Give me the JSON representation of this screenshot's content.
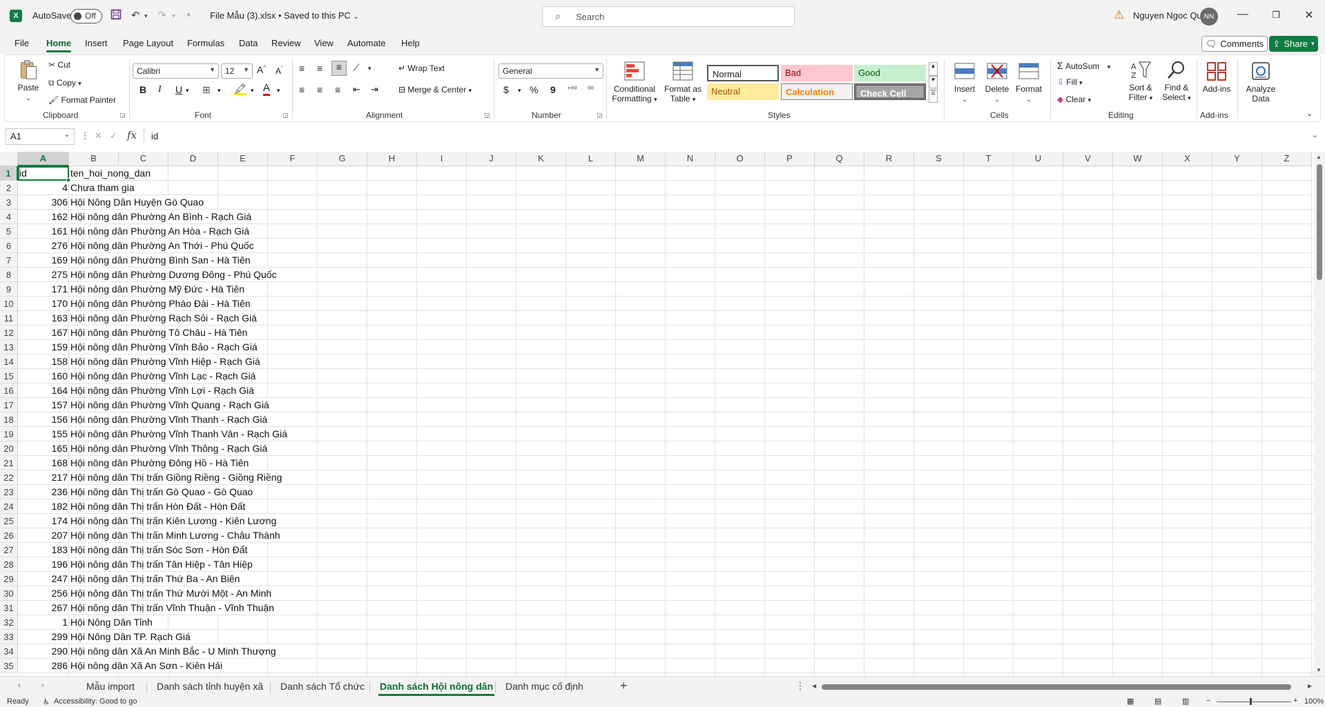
{
  "titlebar": {
    "autosave_label": "AutoSave",
    "autosave_state": "Off",
    "file_title": "File Mẫu (3).xlsx • Saved to this PC",
    "search_placeholder": "Search",
    "user_name": "Nguyen Ngoc Qui",
    "user_initials": "NN"
  },
  "menu": {
    "tabs": [
      "File",
      "Home",
      "Insert",
      "Page Layout",
      "Formulas",
      "Data",
      "Review",
      "View",
      "Automate",
      "Help"
    ],
    "active": "Home",
    "comments_label": "Comments",
    "share_label": "Share"
  },
  "ribbon": {
    "clipboard": {
      "paste": "Paste",
      "cut": "Cut",
      "copy": "Copy",
      "format_painter": "Format Painter",
      "label": "Clipboard"
    },
    "font": {
      "name": "Calibri",
      "size": "12",
      "label": "Font",
      "bold": "B",
      "italic": "I",
      "underline": "U",
      "grow": "A",
      "shrink": "A"
    },
    "alignment": {
      "wrap_text": "Wrap Text",
      "merge_center": "Merge & Center",
      "label": "Alignment"
    },
    "number": {
      "format": "General",
      "label": "Number",
      "currency": "$",
      "percent": "%",
      "comma": "9"
    },
    "styles": {
      "conditional_formatting": "Conditional Formatting",
      "format_as_table": "Format as Table",
      "normal": "Normal",
      "bad": "Bad",
      "good": "Good",
      "neutral": "Neutral",
      "calculation": "Calculation",
      "check_cell": "Check Cell",
      "label": "Styles"
    },
    "cells": {
      "insert": "Insert",
      "delete": "Delete",
      "format": "Format",
      "label": "Cells"
    },
    "editing": {
      "autosum": "AutoSum",
      "fill": "Fill",
      "clear": "Clear",
      "sort_filter": "Sort & Filter",
      "find_select": "Find & Select",
      "label": "Editing"
    },
    "addins": {
      "addins": "Add-ins",
      "label": "Add-ins"
    },
    "analyze": {
      "label": "Analyze Data"
    }
  },
  "formula_bar": {
    "name_box": "A1",
    "fx": "fx",
    "content": "id"
  },
  "grid": {
    "columns": [
      "A",
      "B",
      "C",
      "D",
      "E",
      "F",
      "G",
      "H",
      "I",
      "J",
      "K",
      "L",
      "M",
      "N",
      "O",
      "P",
      "Q",
      "R",
      "S",
      "T",
      "U",
      "V",
      "W",
      "X",
      "Y",
      "Z"
    ],
    "row_numbers": [
      "1",
      "2",
      "3",
      "4",
      "5",
      "6",
      "7",
      "8",
      "9",
      "10",
      "11",
      "12",
      "13",
      "14",
      "15",
      "16",
      "17",
      "18",
      "19",
      "20",
      "21",
      "22",
      "23",
      "24",
      "25",
      "26",
      "27",
      "28",
      "29",
      "30",
      "31",
      "32",
      "33",
      "34",
      "35"
    ],
    "rows": [
      [
        "id",
        "ten_hoi_nong_dan"
      ],
      [
        "4",
        "Chưa tham gia"
      ],
      [
        "306",
        "Hội Nông Dân Huyện Gò Quao"
      ],
      [
        "162",
        "Hội nông dân Phường An Bình -  Rạch Giá"
      ],
      [
        "161",
        "Hội nông dân Phường An Hòa -  Rạch Giá"
      ],
      [
        "276",
        "Hội nông dân Phường An Thới -  Phú Quốc"
      ],
      [
        "169",
        "Hội nông dân Phường Bình San -  Hà Tiên"
      ],
      [
        "275",
        "Hội nông dân Phường Dương Đông -  Phú Quốc"
      ],
      [
        "171",
        "Hội nông dân Phường Mỹ Đức -  Hà Tiên"
      ],
      [
        "170",
        "Hội nông dân Phường Pháo Đài -  Hà Tiên"
      ],
      [
        "163",
        "Hội nông dân Phường Rạch Sỏi -  Rạch Giá"
      ],
      [
        "167",
        "Hội nông dân Phường Tô Châu -  Hà Tiên"
      ],
      [
        "159",
        "Hội nông dân Phường Vĩnh Bảo -  Rạch Giá"
      ],
      [
        "158",
        "Hội nông dân Phường Vĩnh Hiệp -  Rạch Giá"
      ],
      [
        "160",
        "Hội nông dân Phường Vĩnh Lạc -  Rạch Giá"
      ],
      [
        "164",
        "Hội nông dân Phường Vĩnh Lợi -  Rạch Giá"
      ],
      [
        "157",
        "Hội nông dân Phường Vĩnh Quang -  Rạch Giá"
      ],
      [
        "156",
        "Hội nông dân Phường Vĩnh Thanh -  Rạch Giá"
      ],
      [
        "155",
        "Hội nông dân Phường Vĩnh Thanh Vân -  Rạch Giá"
      ],
      [
        "165",
        "Hội nông dân Phường Vĩnh Thông -  Rạch Giá"
      ],
      [
        "168",
        "Hội nông dân Phường Đông Hồ -  Hà Tiên"
      ],
      [
        "217",
        "Hội nông dân Thị trấn Giồng Riềng -  Giồng Riềng"
      ],
      [
        "236",
        "Hội nông dân Thị trấn Gò Quao -  Gò Quao"
      ],
      [
        "182",
        "Hội nông dân Thị trấn Hòn Đất -  Hòn Đất"
      ],
      [
        "174",
        "Hội nông dân Thị trấn Kiên Lương -  Kiên Lương"
      ],
      [
        "207",
        "Hội nông dân Thị trấn Minh Lương -  Châu Thành"
      ],
      [
        "183",
        "Hội nông dân Thị trấn Sóc Sơn -  Hòn Đất"
      ],
      [
        "196",
        "Hội nông dân Thị trấn Tân Hiệp -  Tân Hiệp"
      ],
      [
        "247",
        "Hội nông dân Thị trấn Thứ Ba -  An Biên"
      ],
      [
        "256",
        "Hội nông dân Thị trấn Thứ Mười Một -  An Minh"
      ],
      [
        "267",
        "Hội nông dân Thị trấn Vĩnh Thuận -  Vĩnh Thuận"
      ],
      [
        "1",
        "Hội Nông Dân Tỉnh"
      ],
      [
        "299",
        "Hội Nông Dân TP. Rạch Giá"
      ],
      [
        "290",
        "Hội nông dân Xã An Minh Bắc -  U Minh Thượng"
      ],
      [
        "286",
        "Hội nông dân Xã An Sơn -  Kiên Hải"
      ]
    ]
  },
  "sheets": {
    "tabs": [
      "Mẫu import",
      "Danh sách tỉnh huyện xã",
      "Danh sách Tổ chức",
      "Danh sách Hội nông dân",
      "Danh mục cố định"
    ],
    "active": "Danh sách Hội nông dân",
    "add": "+"
  },
  "statusbar": {
    "ready": "Ready",
    "accessibility": "Accessibility: Good to go",
    "zoom": "100%"
  }
}
